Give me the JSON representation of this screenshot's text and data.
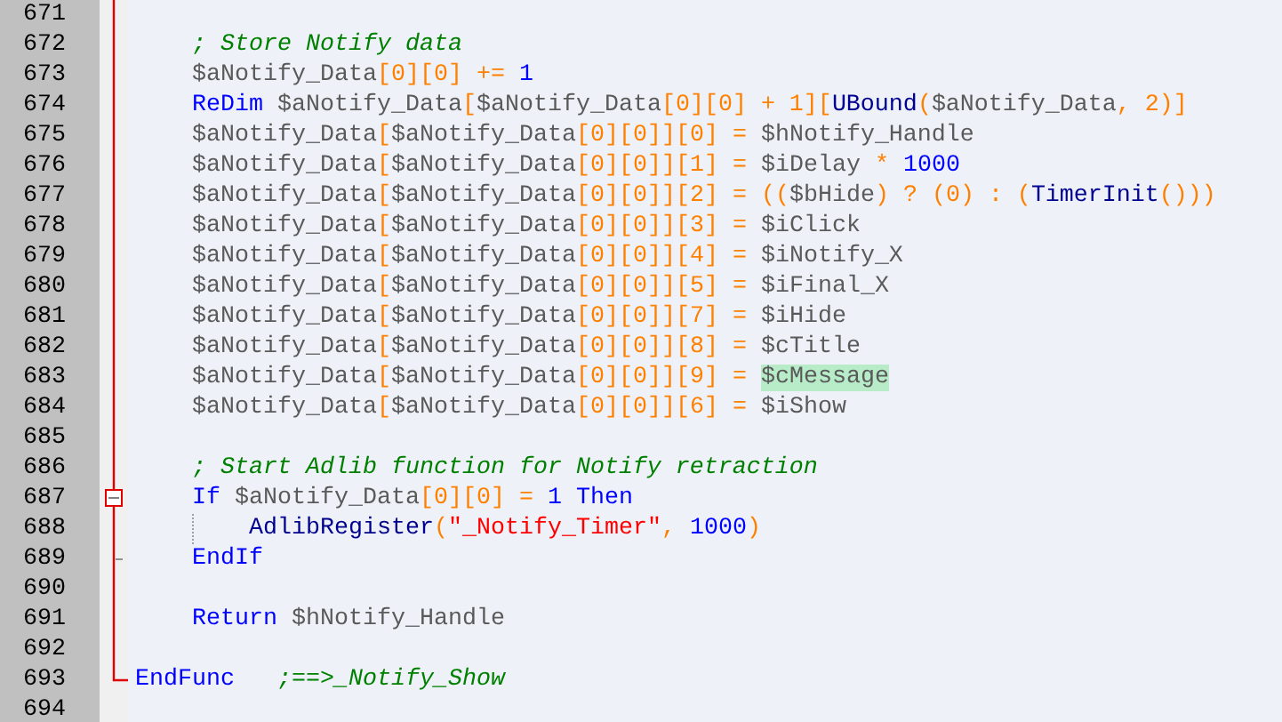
{
  "editor": {
    "lines": [
      {
        "number": "671",
        "kind": "body",
        "guide": false
      },
      {
        "number": "672",
        "kind": "body",
        "guide": false,
        "tokens": [
          {
            "kind": "comment",
            "text": "    ; Store Notify data"
          }
        ]
      },
      {
        "number": "673",
        "kind": "body",
        "guide": false,
        "tokens": [
          {
            "kind": "var",
            "text": "    $aNotify_Data"
          },
          {
            "kind": "op",
            "text": "[0][0] += "
          },
          {
            "kind": "num",
            "text": "1"
          }
        ]
      },
      {
        "number": "674",
        "kind": "body",
        "guide": false,
        "tokens": [
          {
            "kind": "keyword",
            "text": "    ReDim "
          },
          {
            "kind": "var",
            "text": "$aNotify_Data"
          },
          {
            "kind": "op",
            "text": "["
          },
          {
            "kind": "var",
            "text": "$aNotify_Data"
          },
          {
            "kind": "op",
            "text": "[0][0] + 1]["
          },
          {
            "kind": "func",
            "text": "UBound"
          },
          {
            "kind": "op",
            "text": "("
          },
          {
            "kind": "var",
            "text": "$aNotify_Data"
          },
          {
            "kind": "op",
            "text": ", 2)]"
          }
        ]
      },
      {
        "number": "675",
        "kind": "body",
        "guide": false,
        "tokens": [
          {
            "kind": "var",
            "text": "    $aNotify_Data"
          },
          {
            "kind": "op",
            "text": "["
          },
          {
            "kind": "var",
            "text": "$aNotify_Data"
          },
          {
            "kind": "op",
            "text": "[0][0]][0] = "
          },
          {
            "kind": "var",
            "text": "$hNotify_Handle"
          }
        ]
      },
      {
        "number": "676",
        "kind": "body",
        "guide": false,
        "tokens": [
          {
            "kind": "var",
            "text": "    $aNotify_Data"
          },
          {
            "kind": "op",
            "text": "["
          },
          {
            "kind": "var",
            "text": "$aNotify_Data"
          },
          {
            "kind": "op",
            "text": "[0][0]][1] = "
          },
          {
            "kind": "var",
            "text": "$iDelay"
          },
          {
            "kind": "op",
            "text": " * "
          },
          {
            "kind": "num",
            "text": "1000"
          }
        ]
      },
      {
        "number": "677",
        "kind": "body",
        "guide": false,
        "tokens": [
          {
            "kind": "var",
            "text": "    $aNotify_Data"
          },
          {
            "kind": "op",
            "text": "["
          },
          {
            "kind": "var",
            "text": "$aNotify_Data"
          },
          {
            "kind": "op",
            "text": "[0][0]][2] = (("
          },
          {
            "kind": "var",
            "text": "$bHide"
          },
          {
            "kind": "op",
            "text": ") ? (0) : ("
          },
          {
            "kind": "func",
            "text": "TimerInit"
          },
          {
            "kind": "op",
            "text": "()))"
          }
        ]
      },
      {
        "number": "678",
        "kind": "body",
        "guide": false,
        "tokens": [
          {
            "kind": "var",
            "text": "    $aNotify_Data"
          },
          {
            "kind": "op",
            "text": "["
          },
          {
            "kind": "var",
            "text": "$aNotify_Data"
          },
          {
            "kind": "op",
            "text": "[0][0]][3] = "
          },
          {
            "kind": "var",
            "text": "$iClick"
          }
        ]
      },
      {
        "number": "679",
        "kind": "body",
        "guide": false,
        "tokens": [
          {
            "kind": "var",
            "text": "    $aNotify_Data"
          },
          {
            "kind": "op",
            "text": "["
          },
          {
            "kind": "var",
            "text": "$aNotify_Data"
          },
          {
            "kind": "op",
            "text": "[0][0]][4] = "
          },
          {
            "kind": "var",
            "text": "$iNotify_X"
          }
        ]
      },
      {
        "number": "680",
        "kind": "body",
        "guide": false,
        "tokens": [
          {
            "kind": "var",
            "text": "    $aNotify_Data"
          },
          {
            "kind": "op",
            "text": "["
          },
          {
            "kind": "var",
            "text": "$aNotify_Data"
          },
          {
            "kind": "op",
            "text": "[0][0]][5] = "
          },
          {
            "kind": "var",
            "text": "$iFinal_X"
          }
        ]
      },
      {
        "number": "681",
        "kind": "body",
        "guide": false,
        "tokens": [
          {
            "kind": "var",
            "text": "    $aNotify_Data"
          },
          {
            "kind": "op",
            "text": "["
          },
          {
            "kind": "var",
            "text": "$aNotify_Data"
          },
          {
            "kind": "op",
            "text": "[0][0]][7] = "
          },
          {
            "kind": "var",
            "text": "$iHide"
          }
        ]
      },
      {
        "number": "682",
        "kind": "body",
        "guide": false,
        "tokens": [
          {
            "kind": "var",
            "text": "    $aNotify_Data"
          },
          {
            "kind": "op",
            "text": "["
          },
          {
            "kind": "var",
            "text": "$aNotify_Data"
          },
          {
            "kind": "op",
            "text": "[0][0]][8] = "
          },
          {
            "kind": "var",
            "text": "$cTitle"
          }
        ]
      },
      {
        "number": "683",
        "kind": "body",
        "guide": false,
        "tokens": [
          {
            "kind": "var",
            "text": "    $aNotify_Data"
          },
          {
            "kind": "op",
            "text": "["
          },
          {
            "kind": "var",
            "text": "$aNotify_Data"
          },
          {
            "kind": "op",
            "text": "[0][0]][9] = "
          },
          {
            "kind": "match",
            "text": "$cMessage"
          }
        ]
      },
      {
        "number": "684",
        "kind": "body",
        "guide": false,
        "tokens": [
          {
            "kind": "var",
            "text": "    $aNotify_Data"
          },
          {
            "kind": "op",
            "text": "["
          },
          {
            "kind": "var",
            "text": "$aNotify_Data"
          },
          {
            "kind": "op",
            "text": "[0][0]][6] = "
          },
          {
            "kind": "var",
            "text": "$iShow"
          }
        ]
      },
      {
        "number": "685",
        "kind": "body",
        "guide": false
      },
      {
        "number": "686",
        "kind": "body",
        "guide": false,
        "tokens": [
          {
            "kind": "comment",
            "text": "    ; Start Adlib function for Notify retraction"
          }
        ]
      },
      {
        "number": "687",
        "kind": "fold-start",
        "expanded": true,
        "guide": false,
        "tokens": [
          {
            "kind": "keyword",
            "text": "    If "
          },
          {
            "kind": "var",
            "text": "$aNotify_Data"
          },
          {
            "kind": "op",
            "text": "[0][0] = "
          },
          {
            "kind": "num",
            "text": "1"
          },
          {
            "kind": "keyword",
            "text": " Then"
          }
        ]
      },
      {
        "number": "688",
        "kind": "body",
        "guide": true,
        "tokens": [
          {
            "kind": "func",
            "text": "        AdlibRegister"
          },
          {
            "kind": "op",
            "text": "("
          },
          {
            "kind": "string",
            "text": "\"_Notify_Timer\""
          },
          {
            "kind": "op",
            "text": ", "
          },
          {
            "kind": "num",
            "text": "1000"
          },
          {
            "kind": "op",
            "text": ")"
          }
        ]
      },
      {
        "number": "689",
        "kind": "fold-tail",
        "guide": false,
        "tokens": [
          {
            "kind": "keyword",
            "text": "    EndIf"
          }
        ]
      },
      {
        "number": "690",
        "kind": "body",
        "guide": false
      },
      {
        "number": "691",
        "kind": "body",
        "guide": false,
        "tokens": [
          {
            "kind": "keyword",
            "text": "    Return "
          },
          {
            "kind": "var",
            "text": "$hNotify_Handle"
          }
        ]
      },
      {
        "number": "692",
        "kind": "body",
        "guide": false
      },
      {
        "number": "693",
        "kind": "fold-end",
        "guide": false,
        "tokens": [
          {
            "kind": "keyword",
            "text": "EndFunc"
          },
          {
            "kind": "comment",
            "text": "   ;==>_Notify_Show"
          }
        ]
      },
      {
        "number": "694",
        "kind": "outside",
        "guide": false
      }
    ]
  }
}
